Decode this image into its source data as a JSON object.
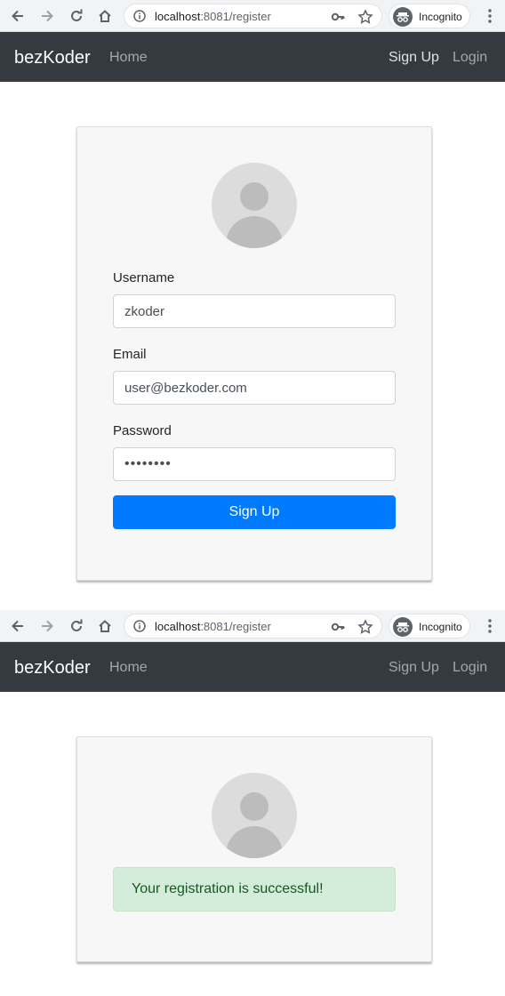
{
  "browser": {
    "url_host": "localhost",
    "url_path": ":8081/register",
    "incognito_label": "Incognito",
    "icons": [
      "back-arrow-icon",
      "forward-arrow-icon",
      "reload-icon",
      "home-icon",
      "info-icon",
      "key-icon",
      "star-icon",
      "incognito-icon",
      "menu-dots-icon"
    ]
  },
  "navbar": {
    "brand": "bezKoder",
    "home": "Home",
    "signup": "Sign Up",
    "login": "Login"
  },
  "form": {
    "username_label": "Username",
    "username_value": "zkoder",
    "email_label": "Email",
    "email_value": "user@bezkoder.com",
    "password_label": "Password",
    "password_value": "••••••••",
    "submit_label": "Sign Up"
  },
  "success": {
    "message": "Your registration is successful!"
  },
  "colors": {
    "navbar_bg": "#343a40",
    "primary": "#007bff",
    "card_bg": "#f7f7f7",
    "alert_bg": "#d4edda",
    "alert_text": "#155724"
  }
}
